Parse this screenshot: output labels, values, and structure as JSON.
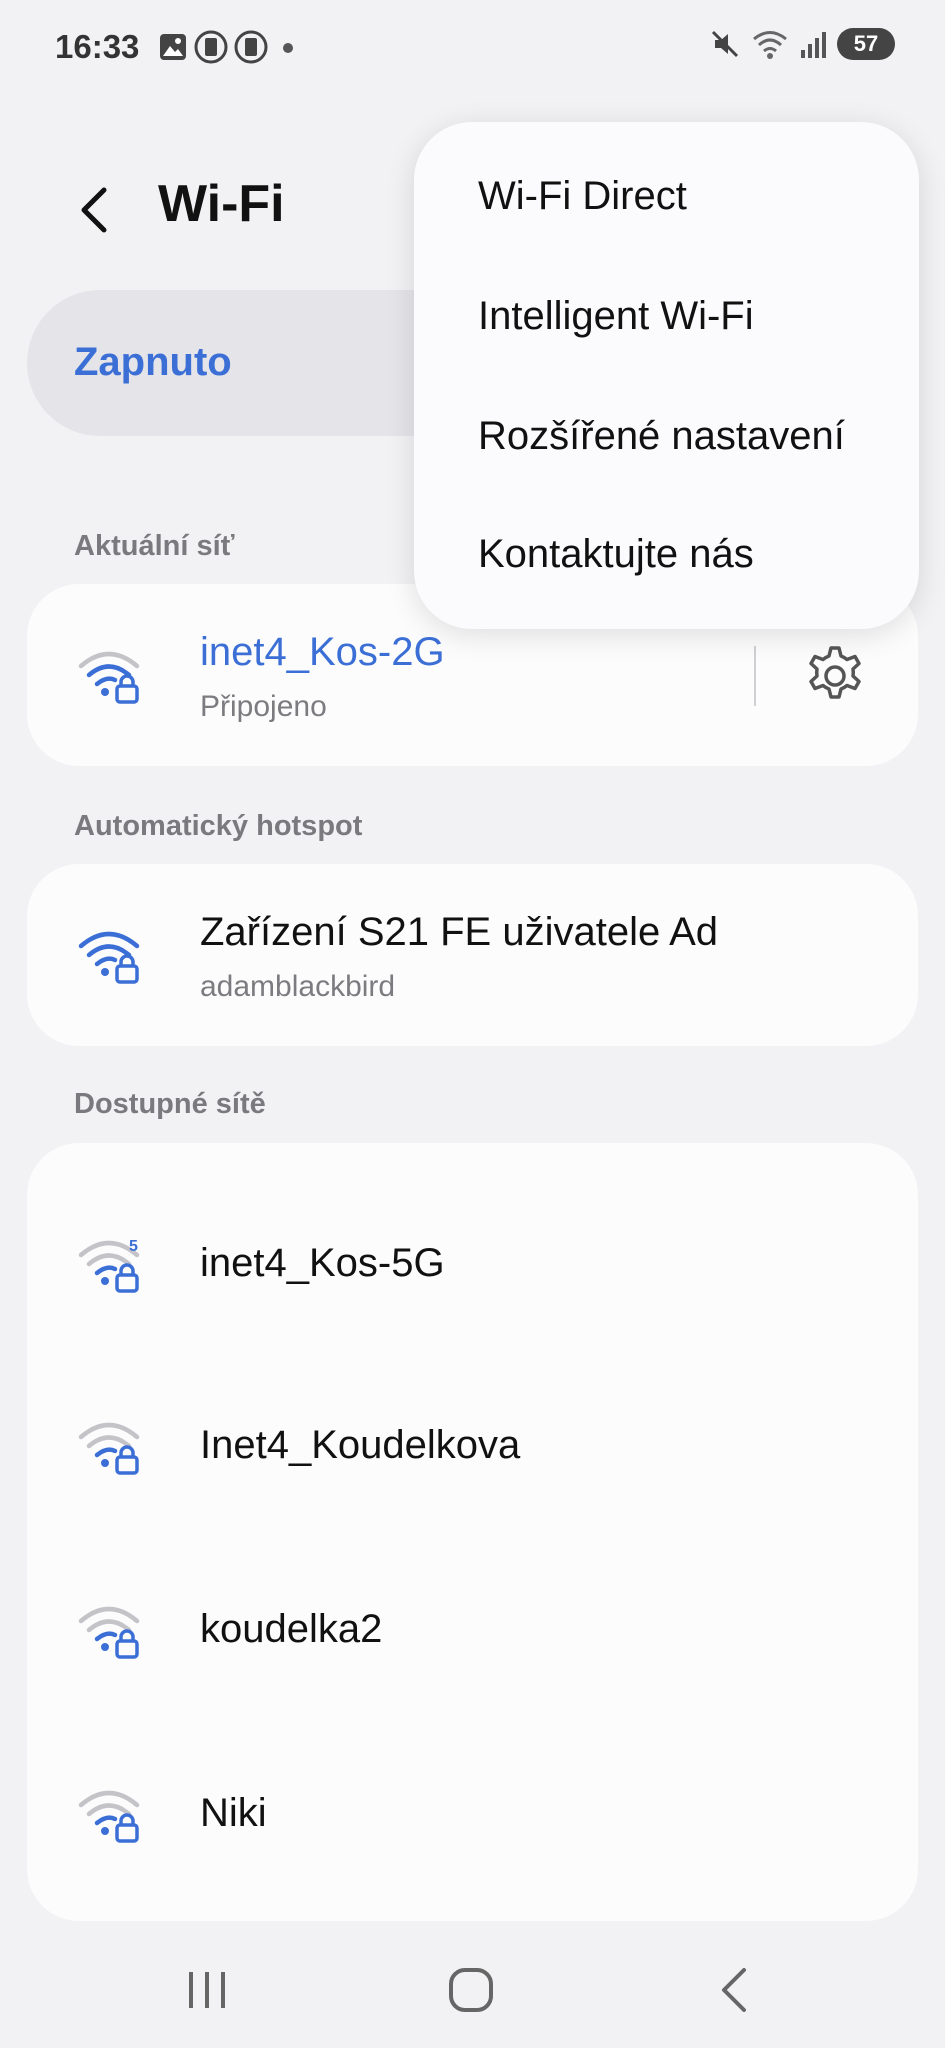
{
  "status_bar": {
    "time": "16:33",
    "left_icons": [
      "gallery-icon",
      "app-icon",
      "app-icon",
      "dot-icon"
    ],
    "right_icons": [
      "mute-icon",
      "wifi-icon",
      "signal-icon"
    ],
    "battery": "57"
  },
  "header": {
    "title": "Wi-Fi",
    "back_icon": "chevron-left-icon"
  },
  "toggle": {
    "label": "Zapnuto",
    "state": "on",
    "accent": "#3b6fd6"
  },
  "sections": {
    "current": {
      "label": "Aktuální síť",
      "network": {
        "name": "inet4_Kos-2G",
        "status": "Připojeno",
        "icon": "wifi-lock-icon"
      },
      "settings_icon": "gear-icon"
    },
    "hotspot": {
      "label": "Automatický hotspot",
      "network": {
        "name": "Zařízení S21 FE uživatele Ad",
        "owner": "adamblackbird",
        "icon": "wifi-lock-icon"
      }
    },
    "available": {
      "label": "Dostupné sítě",
      "networks": [
        {
          "name": "inet4_Kos-5G",
          "band": "5"
        },
        {
          "name": "Inet4_Koudelkova"
        },
        {
          "name": "koudelka2"
        },
        {
          "name": "Niki"
        }
      ]
    }
  },
  "menu": {
    "items": [
      "Wi-Fi Direct",
      "Intelligent Wi-Fi",
      "Rozšířené nastavení",
      "Kontaktujte nás"
    ]
  },
  "nav": {
    "buttons": [
      "recents-icon",
      "home-icon",
      "back-icon"
    ]
  },
  "colors": {
    "accent": "#3b6fd6",
    "background": "#f2f2f4",
    "card": "#fcfcfd"
  }
}
